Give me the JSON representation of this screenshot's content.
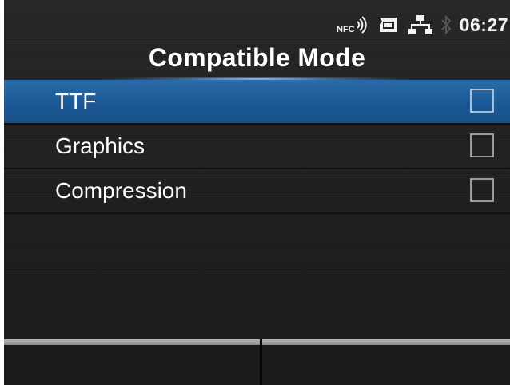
{
  "status_bar": {
    "icons": [
      "nfc-icon",
      "sd-card-icon",
      "network-icon",
      "bluetooth-icon"
    ],
    "time": "06:27"
  },
  "header": {
    "title": "Compatible Mode"
  },
  "menu": {
    "items": [
      {
        "label": "TTF",
        "selected": true,
        "checked": false
      },
      {
        "label": "Graphics",
        "selected": false,
        "checked": false
      },
      {
        "label": "Compression",
        "selected": false,
        "checked": false
      }
    ]
  },
  "softkeys": {
    "left_label": "",
    "right_label": ""
  },
  "colors": {
    "selection": "#1f5f9c",
    "background": "#222222",
    "text": "#ffffff"
  }
}
